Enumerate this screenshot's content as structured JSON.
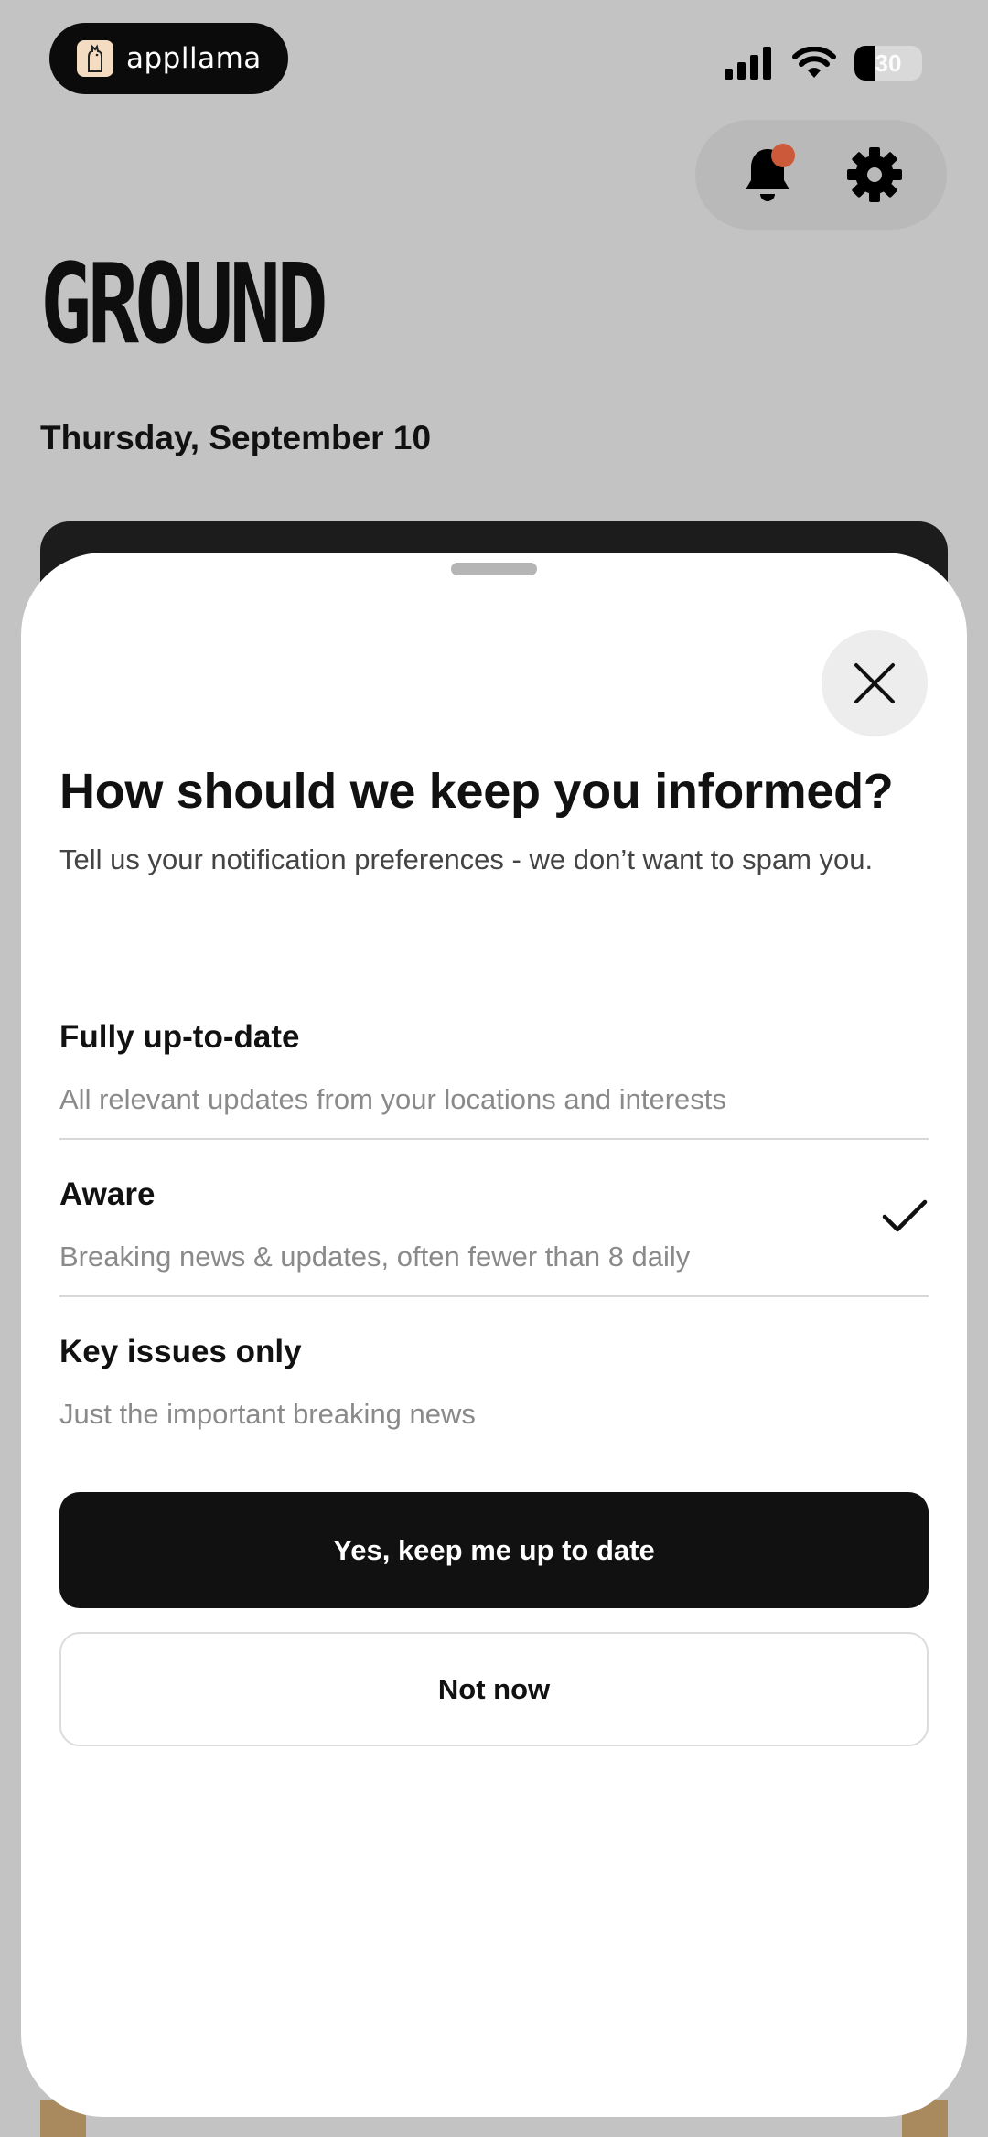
{
  "status_bar": {
    "app_badge_name": "appllama",
    "battery_level": "30",
    "icons": [
      "cellular-signal-icon",
      "wifi-icon",
      "battery-icon"
    ]
  },
  "header": {
    "icons": [
      "bell-icon",
      "gear-icon"
    ],
    "notification_dot_color": "#cc5a3a"
  },
  "background": {
    "wordmark": "GROUND",
    "date": "Thursday, September 10"
  },
  "sheet": {
    "title": "How should we keep you informed?",
    "subtitle": "Tell us your notification preferences - we don’t want to spam you.",
    "options": [
      {
        "label": "Fully up-to-date",
        "description": "All relevant updates from your locations and interests",
        "selected": false
      },
      {
        "label": "Aware",
        "description": "Breaking news & updates, often fewer than 8 daily",
        "selected": true
      },
      {
        "label": "Key issues only",
        "description": "Just the important breaking news",
        "selected": false
      }
    ],
    "primary_button": "Yes, keep me up to date",
    "secondary_button": "Not now"
  },
  "colors": {
    "overlay": "#c3c3c3",
    "primary": "#111111",
    "accent": "#cc5a3a"
  }
}
